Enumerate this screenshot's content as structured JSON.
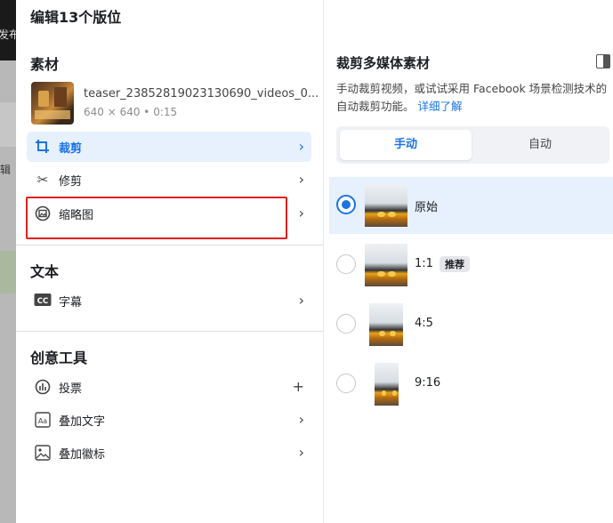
{
  "backdrop": {
    "text_top": "发布",
    "text_mid": "辑"
  },
  "dialog": {
    "title": "编辑13个版位"
  },
  "left": {
    "assets_heading": "素材",
    "asset": {
      "name": "teaser_23852819023130690_videos_0...",
      "meta": "640 × 640 • 0:15"
    },
    "asset_items": [
      {
        "label": "裁剪",
        "icon": "crop-icon",
        "selected": true
      },
      {
        "label": "修剪",
        "icon": "scissors-icon",
        "selected": false
      },
      {
        "label": "缩略图",
        "icon": "thumbnail-icon",
        "selected": false
      }
    ],
    "text_heading": "文本",
    "text_items": [
      {
        "label": "字幕",
        "icon": "cc-icon"
      }
    ],
    "creative_heading": "创意工具",
    "creative_items": [
      {
        "label": "投票",
        "icon": "poll-icon",
        "action": "+"
      },
      {
        "label": "叠加文字",
        "icon": "text-overlay-icon",
        "action": "›"
      },
      {
        "label": "叠加徽标",
        "icon": "logo-overlay-icon",
        "action": "›"
      }
    ]
  },
  "right": {
    "title": "裁剪多媒体素材",
    "desc": "手动裁剪视频，或试试采用 Facebook 场景检测技术的自动裁剪功能。",
    "learn_more": "详细了解",
    "tabs": {
      "manual": "手动",
      "auto": "自动"
    },
    "options": [
      {
        "label": "原始",
        "selected": true
      },
      {
        "label": "1:1",
        "badge": "推荐",
        "selected": false
      },
      {
        "label": "4:5",
        "selected": false
      },
      {
        "label": "9:16",
        "selected": false
      }
    ]
  },
  "colors": {
    "accent": "#1b74e4",
    "selected_bg": "#e7f0fd",
    "highlight": "#e0201c"
  }
}
